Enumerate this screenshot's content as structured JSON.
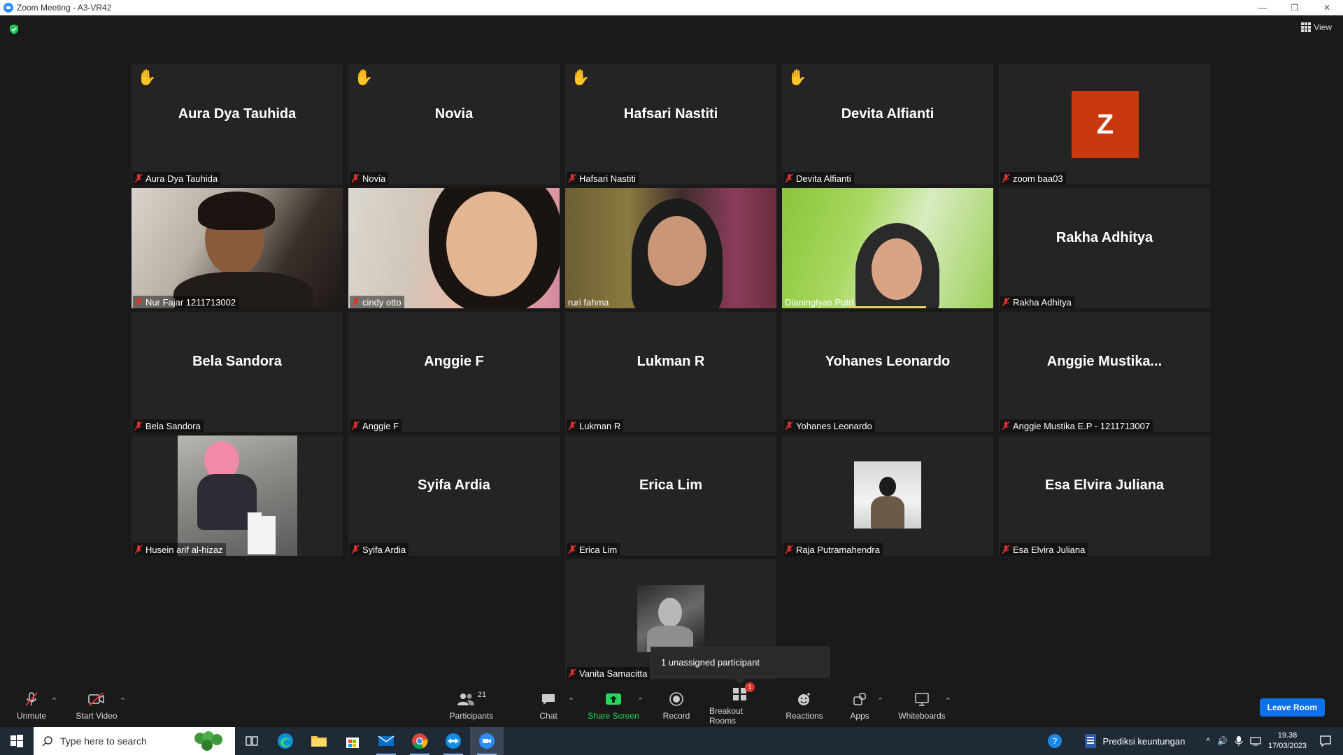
{
  "window": {
    "title": "Zoom Meeting - A3-VR42",
    "minimize": "—",
    "restore": "❐",
    "close": "✕"
  },
  "header": {
    "view_label": "View"
  },
  "tiles": [
    {
      "big_name": "Aura Dya Tauhida",
      "label": "Aura Dya Tauhida",
      "hand_raised": true
    },
    {
      "big_name": "Novia",
      "label": "Novia",
      "hand_raised": true
    },
    {
      "big_name": "Hafsari Nastiti",
      "label": "Hafsari Nastiti",
      "hand_raised": true
    },
    {
      "big_name": "Devita Alfianti",
      "label": "Devita Alfianti",
      "hand_raised": true
    },
    {
      "avatar_letter": "Z",
      "label": "zoom baa03"
    },
    {
      "label": "Nur Fajar 1211713002",
      "video": true
    },
    {
      "label": "cindy otto",
      "video": true
    },
    {
      "label": "ruri fahma",
      "video": true,
      "active_speaker": true
    },
    {
      "label": "Dianingtyas Putri",
      "video": true,
      "unmuted": true
    },
    {
      "big_name": "Rakha Adhitya",
      "label": "Rakha Adhitya"
    },
    {
      "big_name": "Bela Sandora",
      "label": "Bela Sandora"
    },
    {
      "big_name": "Anggie F",
      "label": "Anggie F"
    },
    {
      "big_name": "Lukman R",
      "label": "Lukman R"
    },
    {
      "big_name": "Yohanes Leonardo",
      "label": "Yohanes Leonardo"
    },
    {
      "big_name": "Anggie  Mustika...",
      "label": "Anggie Mustika E.P - 1211713007"
    },
    {
      "label": "Husein arif al-hizaz",
      "photo": true
    },
    {
      "big_name": "Syifa Ardia",
      "label": "Syifa Ardia"
    },
    {
      "big_name": "Erica Lim",
      "label": "Erica Lim"
    },
    {
      "label": "Raja Putramahendra",
      "photo": true
    },
    {
      "big_name": "Esa Elvira Juliana",
      "label": "Esa Elvira Juliana"
    },
    {
      "label": "Vanita Samacitta",
      "photo": true
    }
  ],
  "tooltip": "1 unassigned participant",
  "toolbar": {
    "unmute": "Unmute",
    "start_video": "Start Video",
    "participants": "Participants",
    "participants_count": "21",
    "chat": "Chat",
    "share_screen": "Share Screen",
    "record": "Record",
    "breakout_rooms": "Breakout Rooms",
    "breakout_badge": "1",
    "reactions": "Reactions",
    "apps": "Apps",
    "whiteboards": "Whiteboards",
    "leave": "Leave Room"
  },
  "taskbar": {
    "search_placeholder": "Type here to search",
    "open_doc": "Prediksi keuntungan",
    "time": "19.38",
    "date": "17/03/2023"
  },
  "colors": {
    "active_speaker": "#e9e96a",
    "share_green": "#23d959",
    "leave_blue": "#0e71eb",
    "avatar_z": "#c8380c",
    "mute_red": "#e0312e"
  }
}
